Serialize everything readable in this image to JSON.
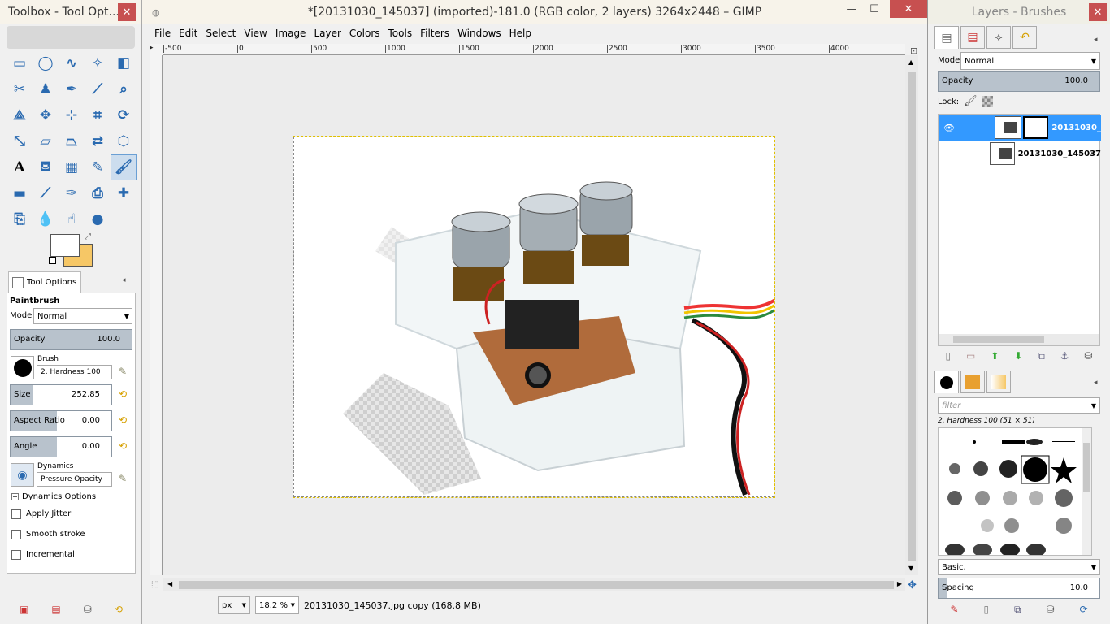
{
  "toolbox": {
    "title": "Toolbox - Tool Opt...",
    "close": "✕",
    "tools": [
      {
        "name": "rect-select-icon",
        "glyph": "▭"
      },
      {
        "name": "ellipse-select-icon",
        "glyph": "◯"
      },
      {
        "name": "free-select-icon",
        "glyph": "∿"
      },
      {
        "name": "fuzzy-select-icon",
        "glyph": "✧"
      },
      {
        "name": "select-by-color-icon",
        "glyph": "◧"
      },
      {
        "name": "scissors-icon",
        "glyph": "✂"
      },
      {
        "name": "foreground-select-icon",
        "glyph": "♟"
      },
      {
        "name": "paths-icon",
        "glyph": "✒"
      },
      {
        "name": "color-picker-icon",
        "glyph": "⟋"
      },
      {
        "name": "zoom-icon",
        "glyph": "⌕"
      },
      {
        "name": "measure-icon",
        "glyph": "⟁"
      },
      {
        "name": "move-icon",
        "glyph": "✥"
      },
      {
        "name": "align-icon",
        "glyph": "⊹"
      },
      {
        "name": "crop-icon",
        "glyph": "⌗"
      },
      {
        "name": "rotate-icon",
        "glyph": "⟳"
      },
      {
        "name": "scale-icon",
        "glyph": "⤡"
      },
      {
        "name": "shear-icon",
        "glyph": "▱"
      },
      {
        "name": "perspective-icon",
        "glyph": "⏢"
      },
      {
        "name": "flip-icon",
        "glyph": "⇄"
      },
      {
        "name": "cage-icon",
        "glyph": "⬡"
      },
      {
        "name": "text-icon",
        "glyph": "A"
      },
      {
        "name": "bucket-fill-icon",
        "glyph": "⛾"
      },
      {
        "name": "blend-icon",
        "glyph": "▦"
      },
      {
        "name": "pencil-icon",
        "glyph": "✎"
      },
      {
        "name": "paintbrush-icon",
        "glyph": "🖌"
      },
      {
        "name": "eraser-icon",
        "glyph": "▬"
      },
      {
        "name": "airbrush-icon",
        "glyph": "⟋"
      },
      {
        "name": "ink-icon",
        "glyph": "✑"
      },
      {
        "name": "clone-icon",
        "glyph": "⎙"
      },
      {
        "name": "heal-icon",
        "glyph": "✚"
      },
      {
        "name": "perspective-clone-icon",
        "glyph": "⎘"
      },
      {
        "name": "blur-icon",
        "glyph": "💧"
      },
      {
        "name": "smudge-icon",
        "glyph": "☝"
      },
      {
        "name": "dodge-burn-icon",
        "glyph": "●"
      }
    ],
    "tool_options_tab": "Tool Options",
    "tool_name": "Paintbrush",
    "mode_label": "Mode:",
    "mode_value": "Normal",
    "opacity_label": "Opacity",
    "opacity_value": "100.0",
    "brush_label": "Brush",
    "brush_value": "2. Hardness 100",
    "size_label": "Size",
    "size_value": "252.85",
    "aspect_label": "Aspect Ratio",
    "aspect_value": "0.00",
    "angle_label": "Angle",
    "angle_value": "0.00",
    "dynamics_label": "Dynamics",
    "dynamics_value": "Pressure Opacity",
    "dynamics_options": "Dynamics Options",
    "apply_jitter": "Apply Jitter",
    "smooth_stroke": "Smooth stroke",
    "incremental": "Incremental"
  },
  "main": {
    "title": "*[20131030_145037] (imported)-181.0 (RGB color, 2 layers) 3264x2448 – GIMP",
    "menu": [
      "File",
      "Edit",
      "Select",
      "View",
      "Image",
      "Layer",
      "Colors",
      "Tools",
      "Filters",
      "Windows",
      "Help"
    ],
    "ruler_labels": [
      "-500",
      "0",
      "500",
      "1000",
      "1500",
      "2000",
      "2500",
      "3000",
      "3500",
      "4000"
    ],
    "unit": "px",
    "zoom": "18.2 %",
    "status": "20131030_145037.jpg copy (168.8 MB)"
  },
  "dock": {
    "title": "Layers - Brushes",
    "mode_label": "Mode:",
    "mode_value": "Normal",
    "opacity_label": "Opacity",
    "opacity_value": "100.0",
    "lock_label": "Lock:",
    "layers": [
      {
        "name": "20131030_",
        "selected": true
      },
      {
        "name": "20131030_145037",
        "selected": false
      }
    ],
    "filter_placeholder": "filter",
    "brush_name": "2. Hardness 100 (51 × 51)",
    "brush_set": "Basic,",
    "spacing_label": "Spacing",
    "spacing_value": "10.0"
  },
  "colors": {
    "accent": "#3399ff",
    "fg": "#ffffff",
    "bg": "#f6c766",
    "close": "#c75050"
  }
}
